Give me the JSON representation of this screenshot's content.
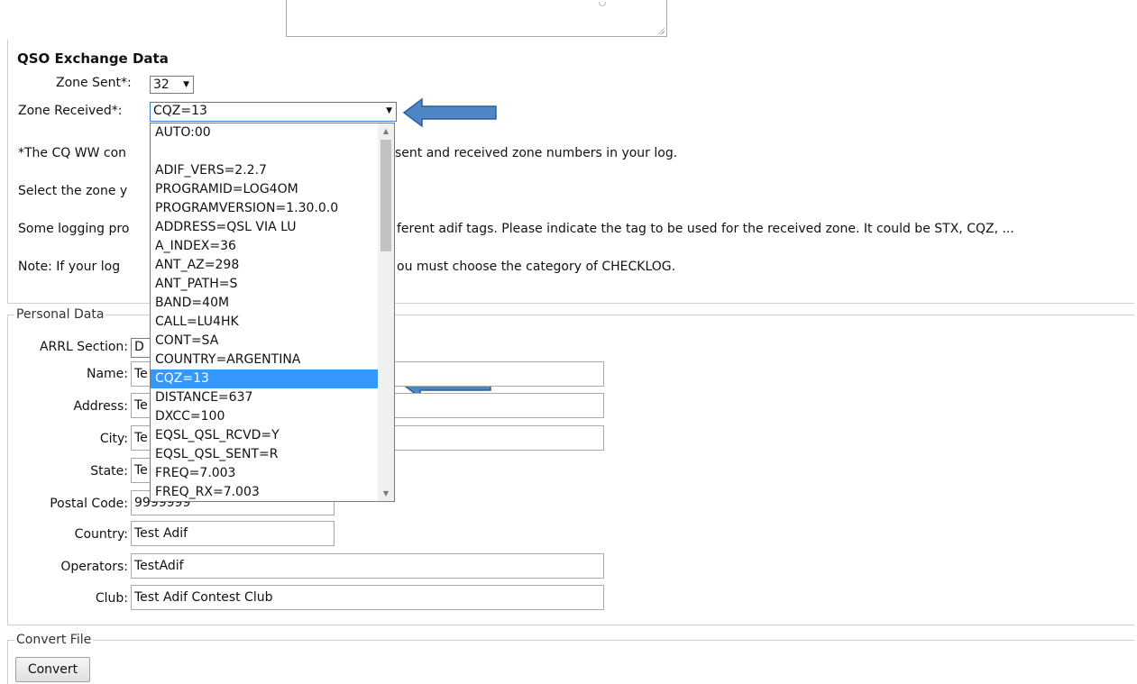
{
  "qso": {
    "title": "QSO Exchange Data",
    "zone_sent_label": "Zone Sent*:",
    "zone_sent_value": "32",
    "zone_received_label": "Zone Received*:",
    "zone_received_value": "CQZ=13"
  },
  "paragraphs": {
    "p1_start": "*The CQ WW con",
    "p1_end": "sent and received zone numbers in your log.",
    "p2_start": "Select the zone y",
    "p3_start": "Some logging pro",
    "p3_end": "ferent adif tags. Please indicate the tag to be used for the received zone. It could be STX, CQZ, ...",
    "p4_start": "Note: If your log",
    "p4_end": "ou must choose the category of CHECKLOG."
  },
  "dropdown": {
    "items": [
      "AUTO:00",
      "",
      "ADIF_VERS=2.2.7",
      "PROGRAMID=LOG4OM",
      "PROGRAMVERSION=1.30.0.0",
      "ADDRESS=QSL VIA LU",
      "A_INDEX=36",
      "ANT_AZ=298",
      "ANT_PATH=S",
      "BAND=40M",
      "CALL=LU4HK",
      "CONT=SA",
      "COUNTRY=ARGENTINA",
      "CQZ=13",
      "DISTANCE=637",
      "DXCC=100",
      "EQSL_QSL_RCVD=Y",
      "EQSL_QSL_SENT=R",
      "FREQ=7.003",
      "FREQ_RX=7.003"
    ],
    "selected": "CQZ=13"
  },
  "personal": {
    "legend": "Personal Data",
    "arrl_label": "ARRL Section:",
    "arrl_value": "D",
    "name_label": "Name:",
    "name_value": "Te",
    "address_label": "Address:",
    "address_value": "Te",
    "city_label": "City:",
    "city_value": "Te",
    "state_label": "State:",
    "state_value": "Te",
    "postal_label": "Postal Code:",
    "postal_value": "9999999",
    "country_label": "Country:",
    "country_value": "Test Adif",
    "operators_label": "Operators:",
    "operators_value": "TestAdif",
    "club_label": "Club:",
    "club_value": "Test Adif Contest Club"
  },
  "convert": {
    "legend": "Convert File",
    "button_label": "Convert"
  },
  "colors": {
    "arrow": "#4f86c6",
    "selection": "#3399ff"
  }
}
